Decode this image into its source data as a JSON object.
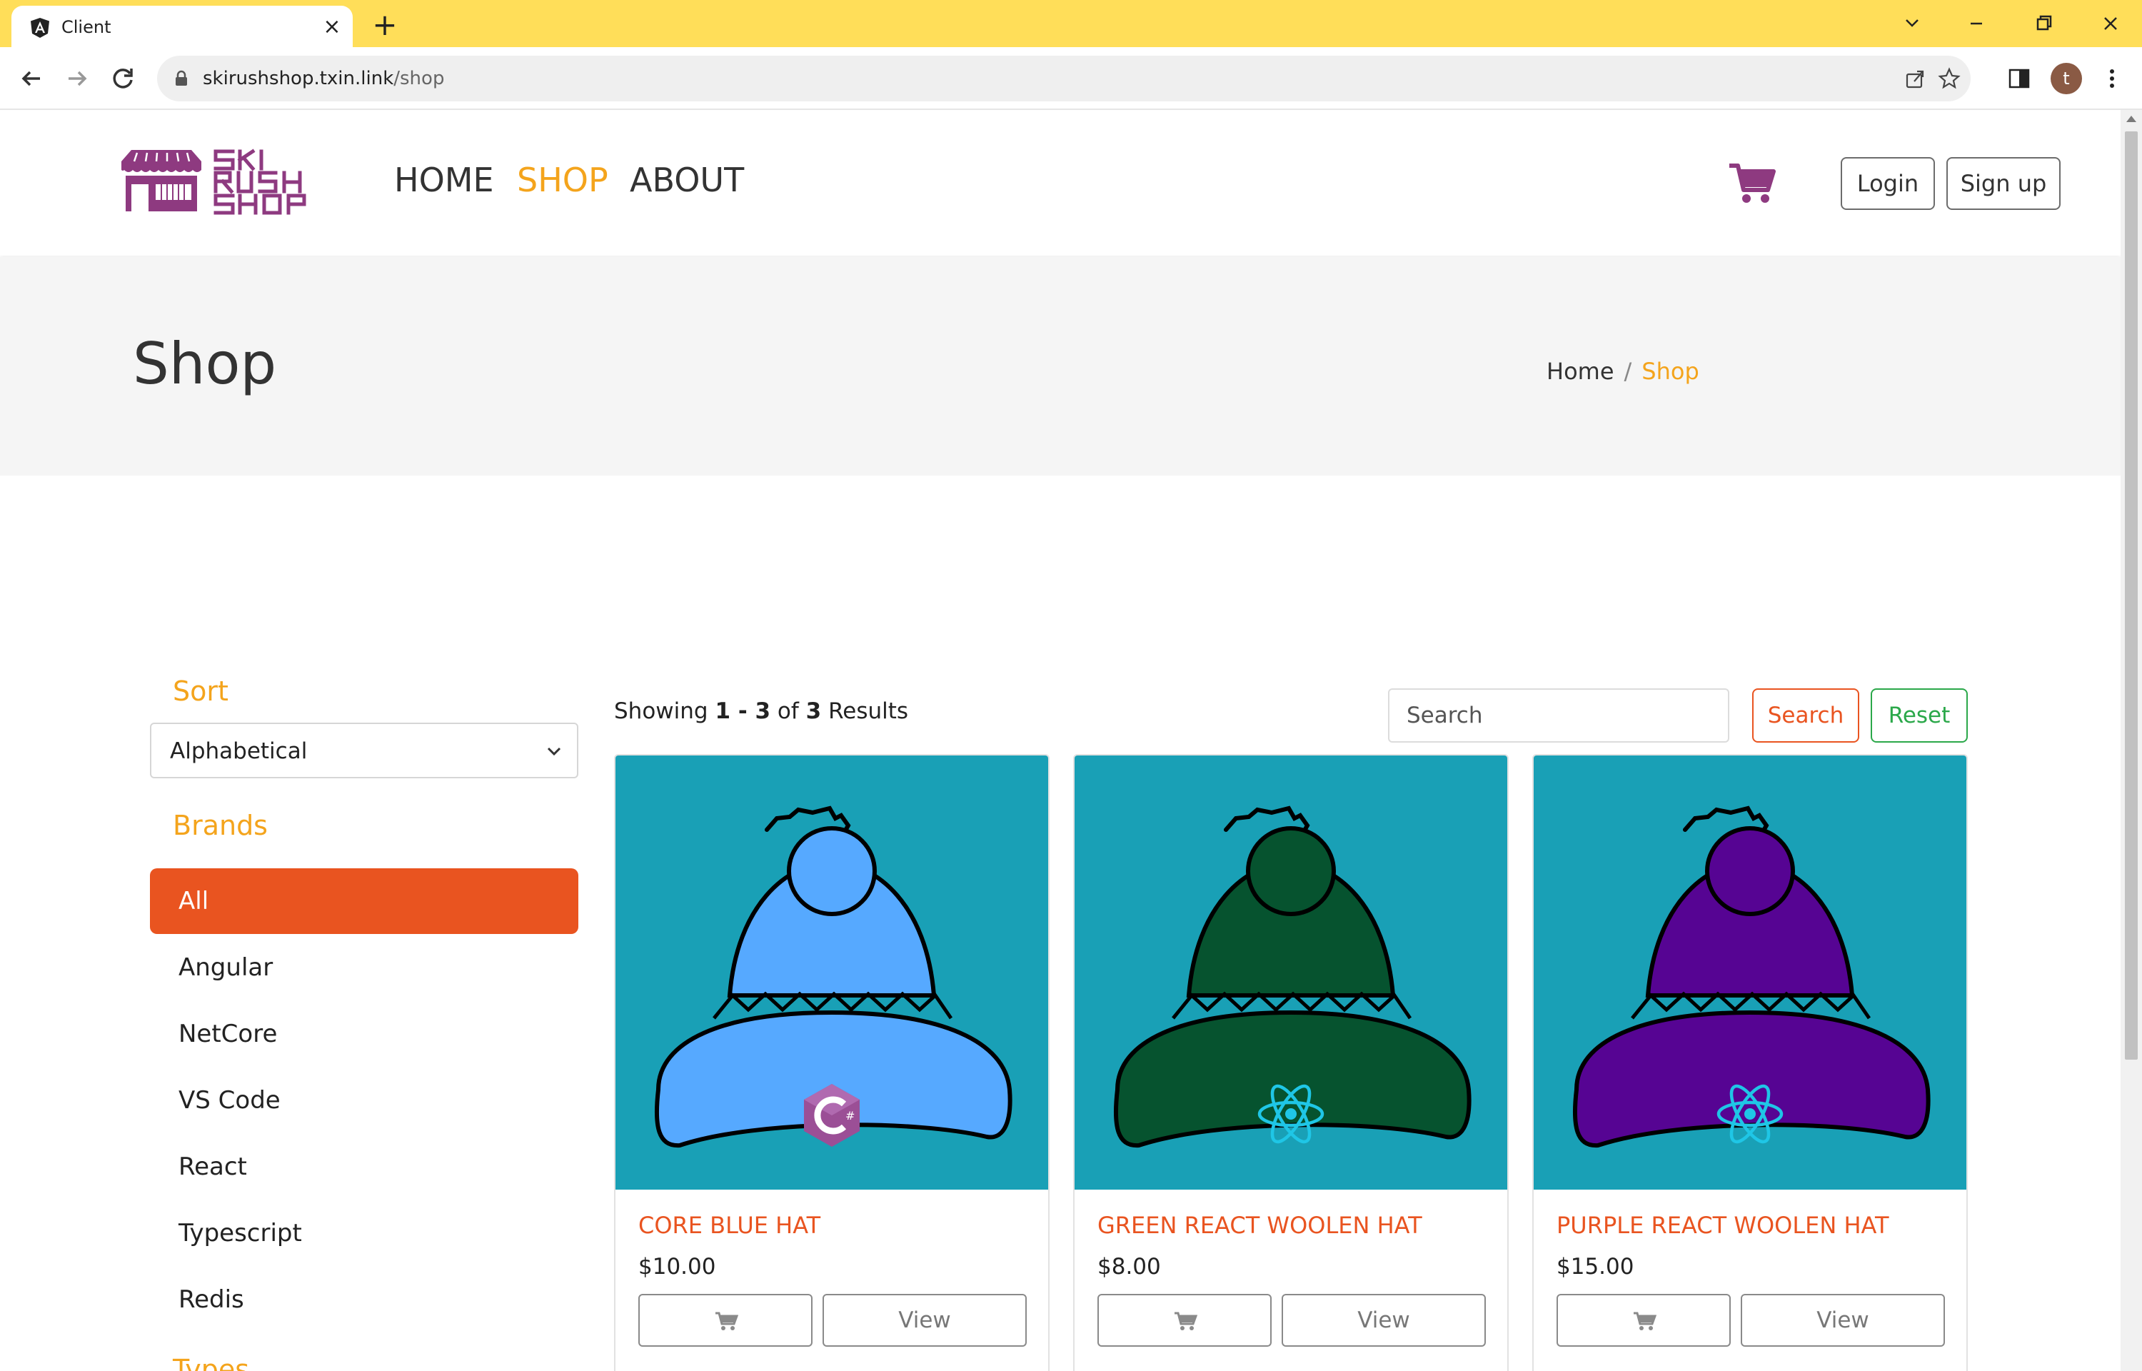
{
  "browser": {
    "tab_title": "Client",
    "url_host": "skirushshop.txin.link",
    "url_path": "/shop",
    "profile_initial": "t"
  },
  "header": {
    "nav": [
      "HOME",
      "SHOP",
      "ABOUT"
    ],
    "login_label": "Login",
    "signup_label": "Sign up"
  },
  "banner": {
    "title": "Shop",
    "breadcrumb": [
      "Home",
      "Shop"
    ]
  },
  "sidebar": {
    "sort_heading": "Sort",
    "sort_value": "Alphabetical",
    "brands_heading": "Brands",
    "brands": [
      "All",
      "Angular",
      "NetCore",
      "VS Code",
      "React",
      "Typescript",
      "Redis"
    ],
    "active_brand": "All",
    "types_heading": "Types"
  },
  "results": {
    "prefix": "Showing",
    "range": "1 - 3",
    "of": "of",
    "total": "3",
    "suffix": "Results"
  },
  "search": {
    "placeholder": "Search",
    "search_label": "Search",
    "reset_label": "Reset"
  },
  "products": [
    {
      "name": "CORE BLUE HAT",
      "price": "$10.00",
      "view_label": "View",
      "hat_color": "#56a9ff",
      "logo": "csharp-logo"
    },
    {
      "name": "GREEN REACT WOOLEN HAT",
      "price": "$8.00",
      "view_label": "View",
      "hat_color": "#06532f",
      "logo": "react-logo"
    },
    {
      "name": "PURPLE REACT WOOLEN HAT",
      "price": "$15.00",
      "view_label": "View",
      "hat_color": "#560493",
      "logo": "react-logo"
    }
  ],
  "colors": {
    "accent_orange": "#f4a41c",
    "primary": "#e95420",
    "success": "#2ba84a",
    "brand_purple": "#8e3a80",
    "card_bg": "#19a0b6",
    "tabbar": "#ffde59"
  }
}
